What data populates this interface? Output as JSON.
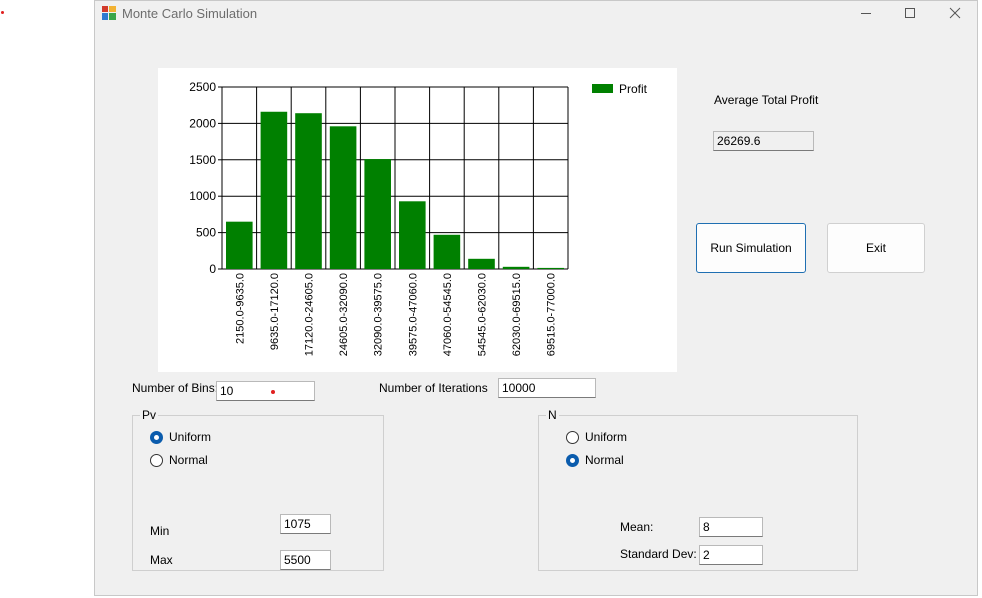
{
  "window": {
    "title": "Monte Carlo Simulation",
    "minimize_icon": "minimize-icon",
    "maximize_icon": "maximize-icon",
    "close_icon": "close-icon"
  },
  "chart_data": {
    "type": "bar",
    "categories": [
      "2150.0-9635.0",
      "9635.0-17120.0",
      "17120.0-24605.0",
      "24605.0-32090.0",
      "32090.0-39575.0",
      "39575.0-47060.0",
      "47060.0-54545.0",
      "54545.0-62030.0",
      "62030.0-69515.0",
      "69515.0-77000.0"
    ],
    "series": [
      {
        "name": "Profit",
        "values": [
          650,
          2160,
          2140,
          1960,
          1510,
          930,
          470,
          140,
          30,
          15
        ]
      }
    ],
    "ylim": [
      0,
      2500
    ],
    "yticks": [
      "0",
      "500",
      "1000",
      "1500",
      "2000",
      "2500"
    ],
    "grid": true,
    "legend": "top-right",
    "color": "#008000"
  },
  "average_total_profit": {
    "label": "Average Total Profit",
    "value": "26269.6"
  },
  "buttons": {
    "run": "Run Simulation",
    "exit": "Exit"
  },
  "bins": {
    "label": "Number of Bins:",
    "value": "10"
  },
  "iterations": {
    "label": "Number of Iterations",
    "value": "10000"
  },
  "pv_group": {
    "title": "Pv",
    "options": [
      "Uniform",
      "Normal"
    ],
    "selected": "Uniform",
    "min_label": "Min",
    "min_value": "1075",
    "max_label": "Max",
    "max_value": "5500"
  },
  "n_group": {
    "title": "N",
    "options": [
      "Uniform",
      "Normal"
    ],
    "selected": "Normal",
    "mean_label": "Mean:",
    "mean_value": "8",
    "std_label": "Standard Dev:",
    "std_value": "2"
  },
  "colors": {
    "accent": "#0b5cad",
    "bar": "#008000"
  }
}
